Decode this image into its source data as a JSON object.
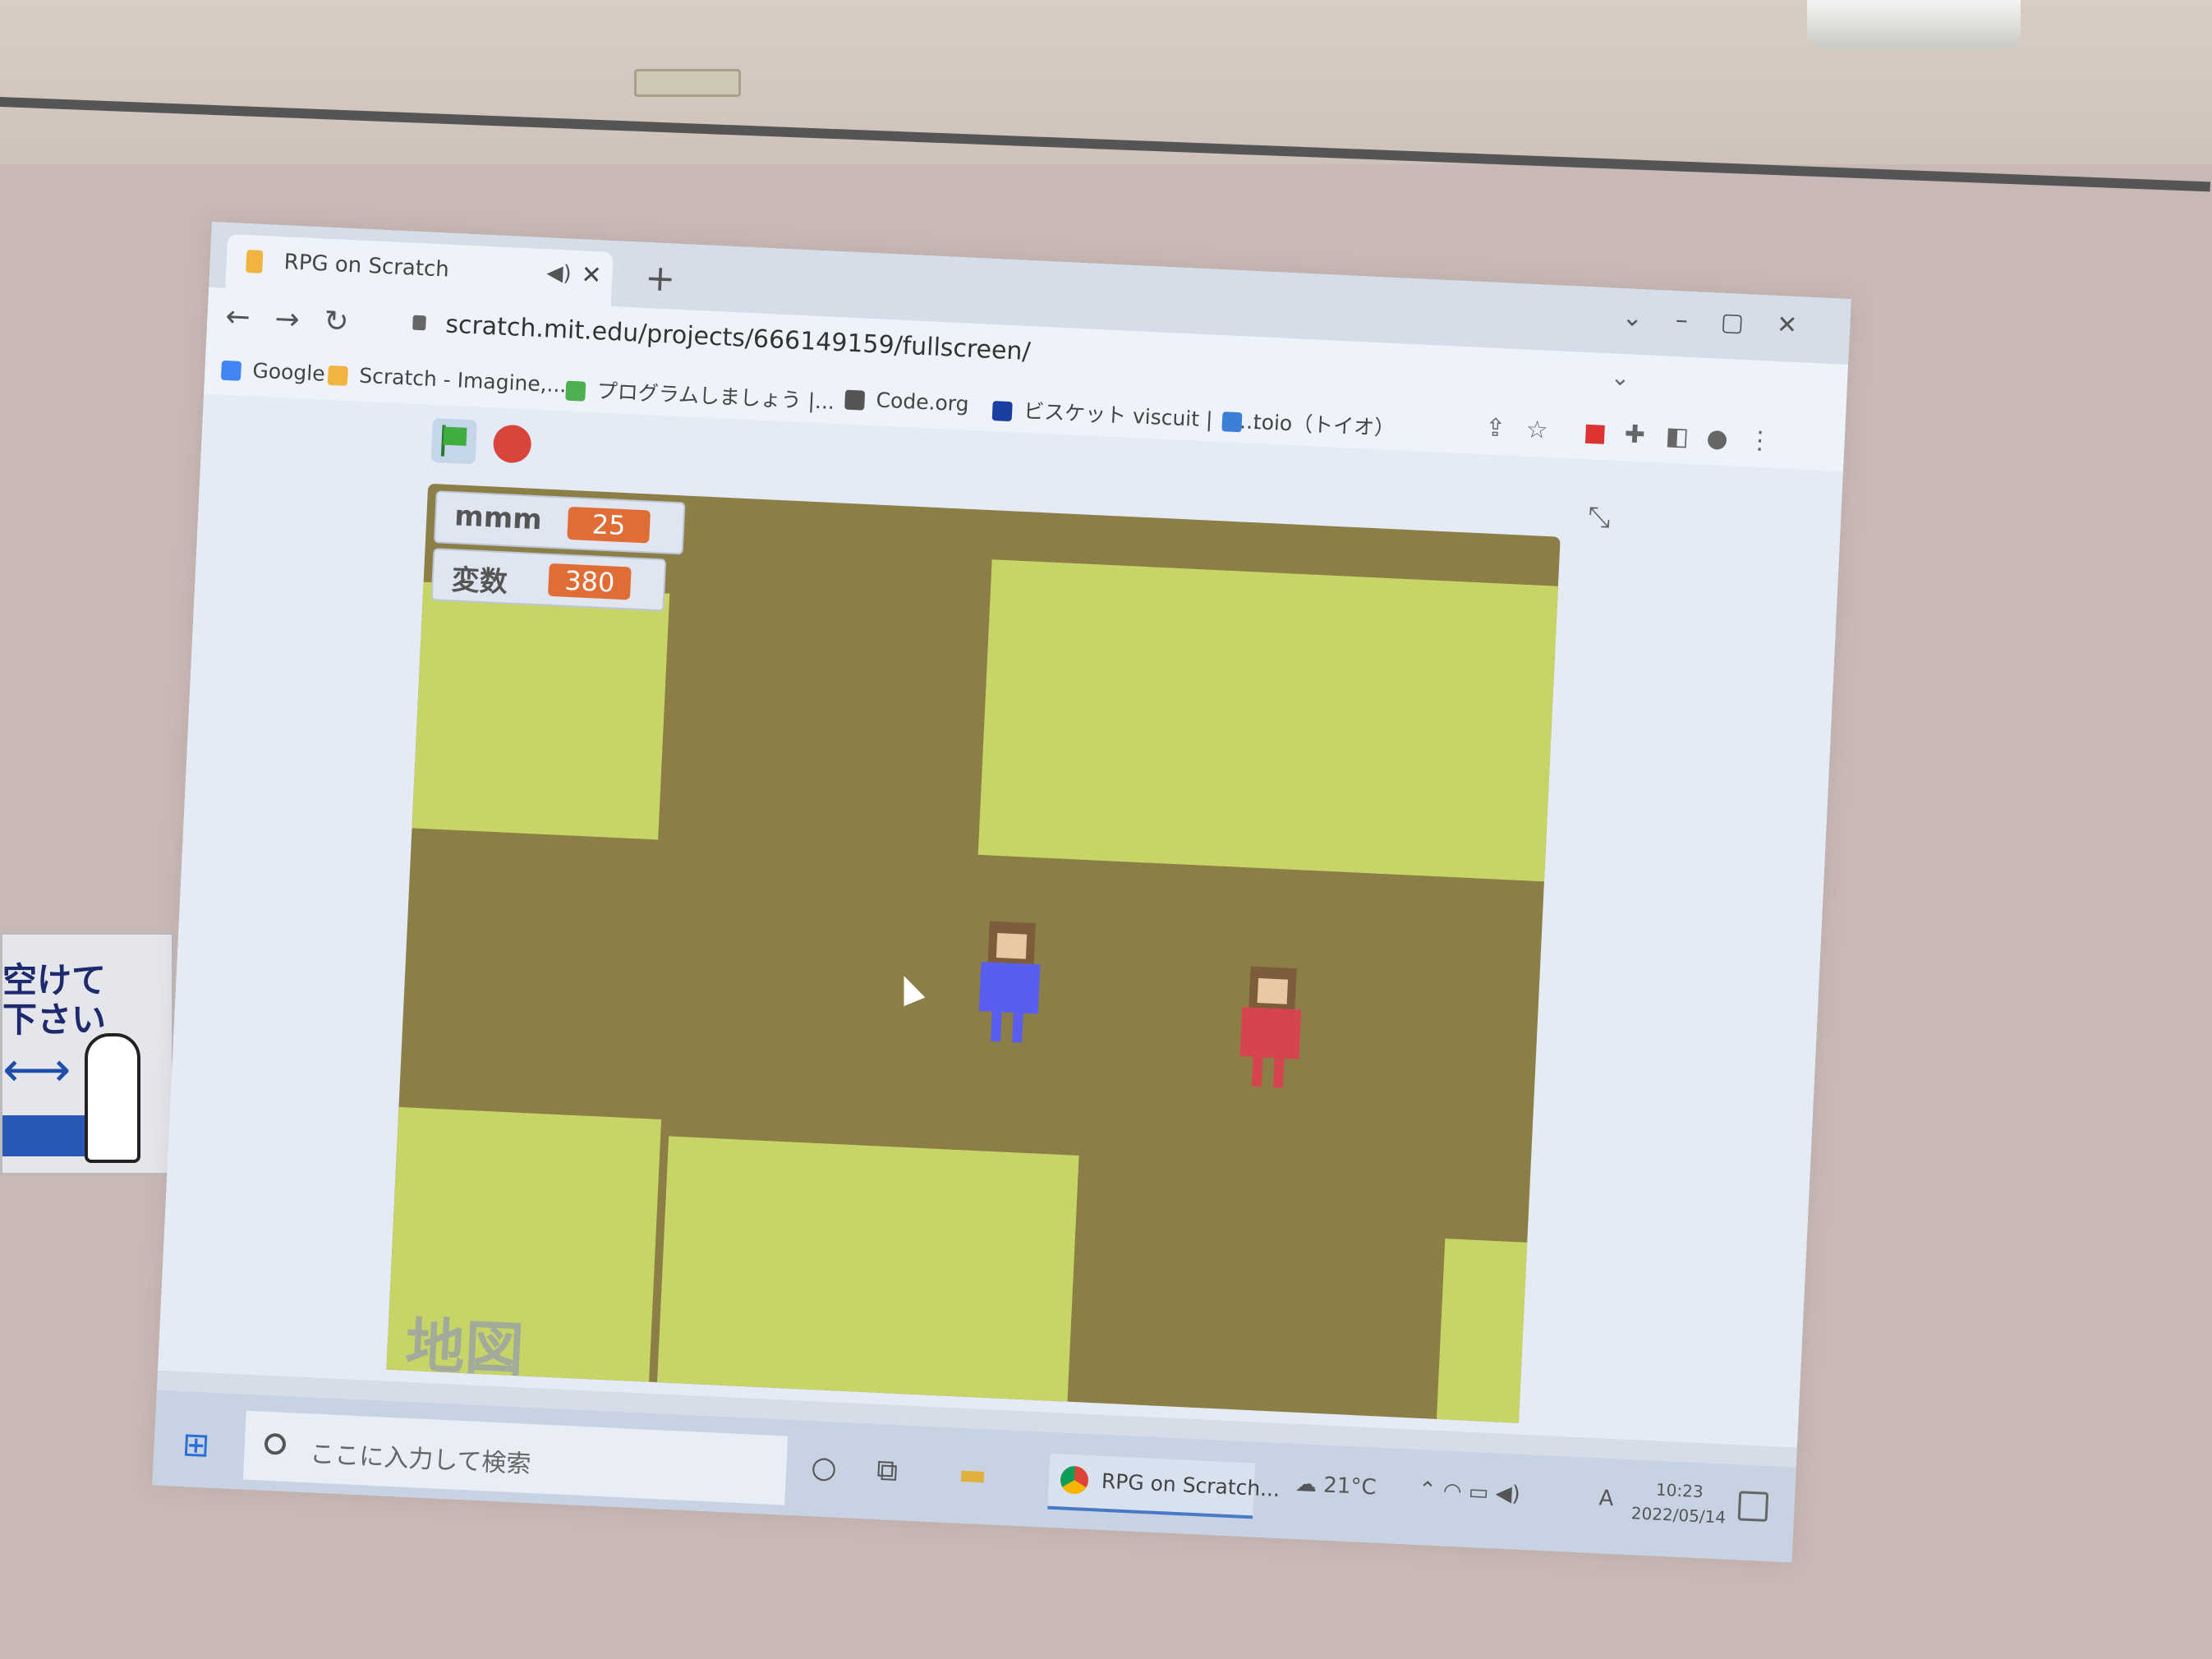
{
  "poster": {
    "text": "空けて\n下さい"
  },
  "browser": {
    "tab_title": "RPG on Scratch",
    "url": "scratch.mit.edu/projects/666149159/fullscreen/",
    "bookmarks": [
      {
        "label": "Google",
        "icon_color": "#4285f4"
      },
      {
        "label": "Scratch - Imagine,...",
        "icon_color": "#f2b440"
      },
      {
        "label": "プログラムしましょう |...",
        "icon_color": "#4caf50"
      },
      {
        "label": "Code.org",
        "icon_color": "#555555"
      },
      {
        "label": "ビスケット viscuit | コ...",
        "icon_color": "#1a3fa0"
      },
      {
        "label": "toio（トイオ）",
        "icon_color": "#3b7fd6"
      }
    ]
  },
  "stage": {
    "monitors": [
      {
        "label": "mmm",
        "value": "25"
      },
      {
        "label": "変数",
        "value": "380"
      }
    ],
    "label": "地図",
    "colors": {
      "ground": "#8c7e47",
      "block": "#c7d466",
      "player": "#5a5ef0",
      "npc": "#d6454f"
    }
  },
  "taskbar": {
    "search_placeholder": "ここに入力して検索",
    "active_app": "RPG on Scratch...",
    "weather": "21°C",
    "time": "10:23",
    "date": "2022/05/14",
    "ime": "A"
  }
}
